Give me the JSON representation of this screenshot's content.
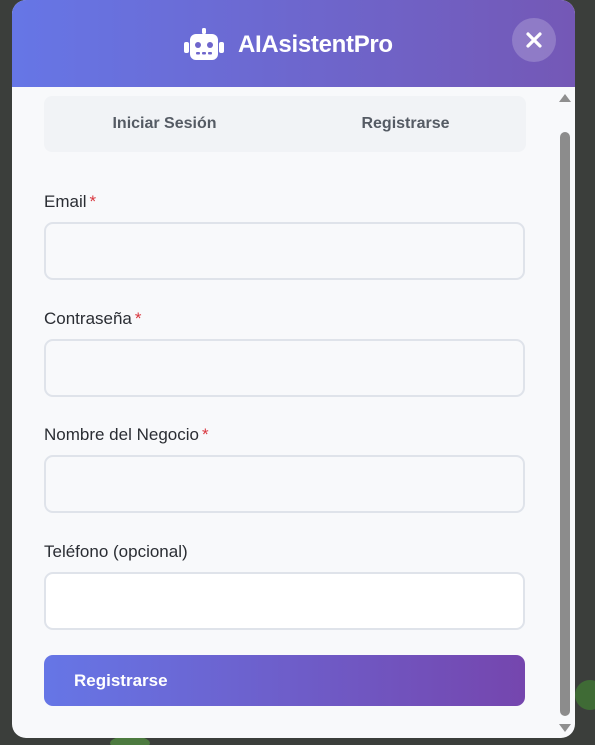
{
  "header": {
    "brand_icon": "robot-icon",
    "app_title": "AIAsistentPro",
    "close_icon": "close-icon",
    "gradient_start": "#6676e6",
    "gradient_end": "#7458b6"
  },
  "tabs": [
    {
      "label": "Iniciar Sesión"
    },
    {
      "label": "Registrarse"
    }
  ],
  "form": {
    "required_marker": "*",
    "fields": [
      {
        "label": "Email",
        "required": true,
        "value": "",
        "placeholder": ""
      },
      {
        "label": "Contraseña",
        "required": true,
        "value": "",
        "placeholder": ""
      },
      {
        "label": "Nombre del Negocio",
        "required": true,
        "value": "",
        "placeholder": ""
      },
      {
        "label": "Teléfono (opcional)",
        "required": false,
        "value": "",
        "placeholder": ""
      }
    ],
    "submit_label": "Registrarse",
    "required_color": "#d9363e"
  }
}
